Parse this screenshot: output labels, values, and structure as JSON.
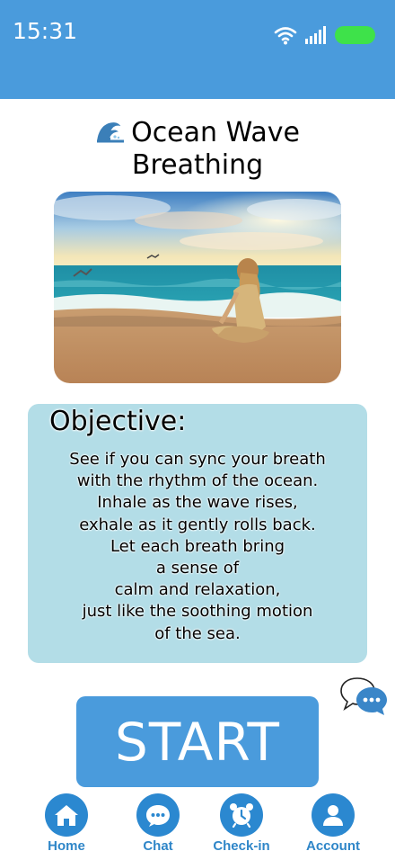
{
  "status": {
    "time": "15:31"
  },
  "header": {
    "title": "Ocean Wave Breathing",
    "title_icon": "ocean-wave-icon"
  },
  "objective": {
    "heading": "Objective:",
    "lines": [
      "See if you can sync your breath",
      "with the rhythm of the ocean.",
      "Inhale as the wave rises,",
      "exhale as it gently rolls back.",
      "Let each breath bring",
      "a sense of",
      "calm and relaxation,",
      "just like the soothing motion",
      "of the sea."
    ]
  },
  "start_label": "START",
  "nav": {
    "items": [
      {
        "label": "Home",
        "icon": "home-icon"
      },
      {
        "label": "Chat",
        "icon": "chat-icon"
      },
      {
        "label": "Check-in",
        "icon": "alarm-clock-icon"
      },
      {
        "label": "Account",
        "icon": "account-icon"
      }
    ]
  },
  "colors": {
    "header_blue": "#4a9bdc",
    "card_bg": "#b3dde7",
    "nav_blue": "#2b88d0",
    "battery_green": "#3ee24a"
  }
}
